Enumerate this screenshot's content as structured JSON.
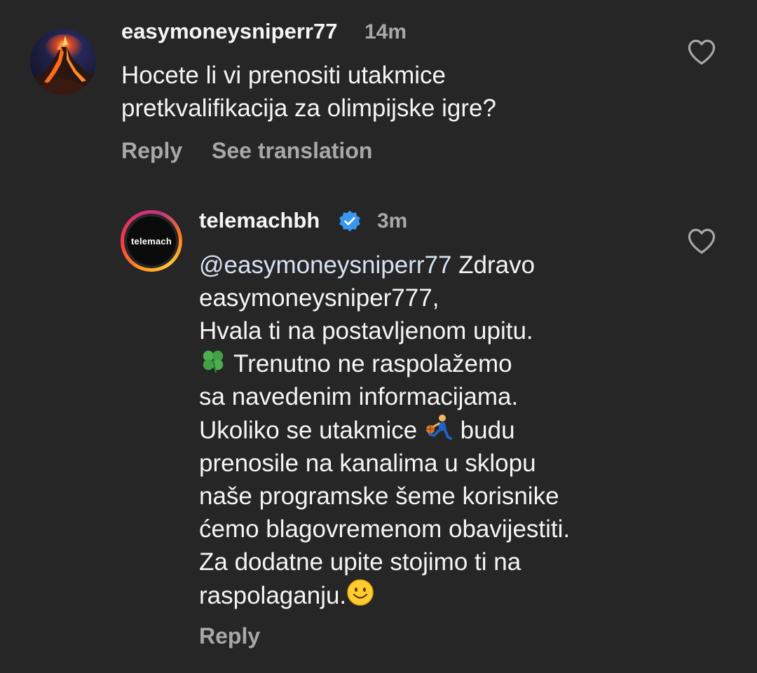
{
  "comments": [
    {
      "username": "easymoneysniperr77",
      "time": "14m",
      "text": "Hocete li vi prenositi utakmice\npretkvalifikacija za olimpijske igre?",
      "actions": {
        "reply": "Reply",
        "translate": "See translation"
      },
      "avatar_icon": "volcano-avatar"
    },
    {
      "username": "telemachbh",
      "verified": true,
      "time": "3m",
      "avatar_text": "telemach",
      "mention": "@easymoneysniperr77",
      "line1_rest": " Zdravo",
      "line2": "easymoneysniper777,",
      "line3": "Hvala ti na postavljenom upitu.",
      "line4": " Trenutno ne raspolažemo",
      "line5": "sa navedenim informacijama.",
      "line6a": "Ukoliko se utakmice ",
      "line6b": " budu",
      "line7": "prenosile na kanalima u sklopu",
      "line8": "naše programske šeme korisnike",
      "line9": "ćemo blagovremenom obavijestiti.",
      "line10": "Za dodatne upite stojimo ti na",
      "line11": "raspolaganju.",
      "actions": {
        "reply": "Reply"
      },
      "emoji_icons": [
        "four-leaf-clover-icon",
        "person-bouncing-ball-icon",
        "smiling-face-icon"
      ]
    }
  ],
  "colors": {
    "background": "#262626",
    "primary_text": "#f5f5f5",
    "secondary_text": "#a8a8a8",
    "verified_blue": "#3897f0",
    "mention": "#d7e3f3"
  }
}
